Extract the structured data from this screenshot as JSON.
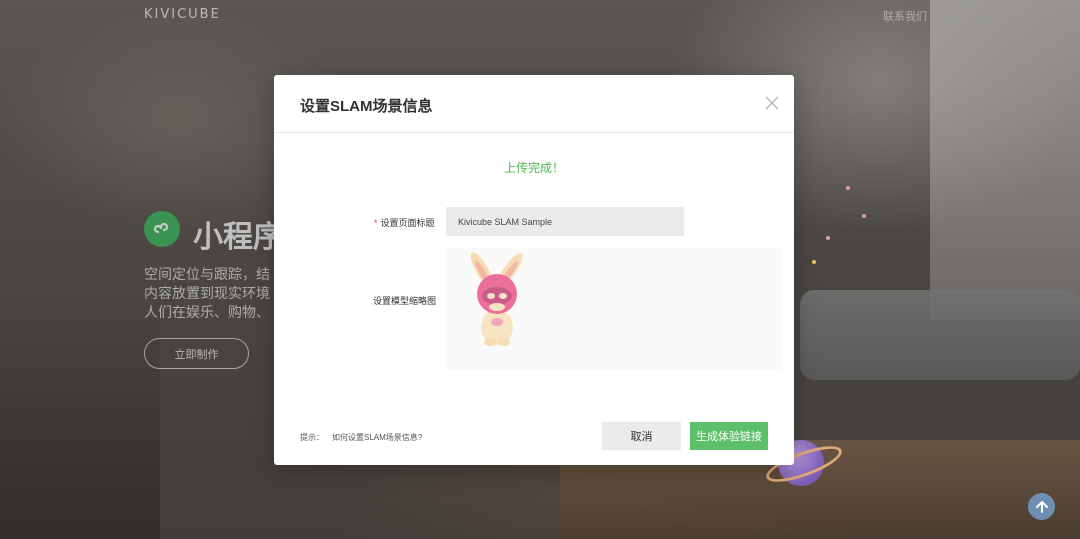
{
  "nav": {
    "brand": "KIVICUBE",
    "contact": "联系我们"
  },
  "hero": {
    "title": "小程序",
    "desc_lines": [
      "空间定位与跟踪，结",
      "内容放置到现实环境",
      "人们在娱乐、购物、"
    ],
    "button": "立即制作",
    "icon": "mini-program-icon"
  },
  "modal": {
    "title": "设置SLAM场景信息",
    "upload_status": "上传完成！",
    "title_field": {
      "required_mark": "*",
      "label": "设置页面标题",
      "value": "Kivicube SLAM Sample"
    },
    "thumb_field": {
      "label": "设置模型缩略图"
    },
    "hint": {
      "prefix": "提示：",
      "link": "如何设置SLAM场景信息?"
    },
    "cancel_label": "取消",
    "generate_label": "生成体验链接"
  },
  "colors": {
    "accent_green": "#5cbf6a",
    "status_green": "#4cb94f",
    "required_red": "#e33b3b"
  }
}
